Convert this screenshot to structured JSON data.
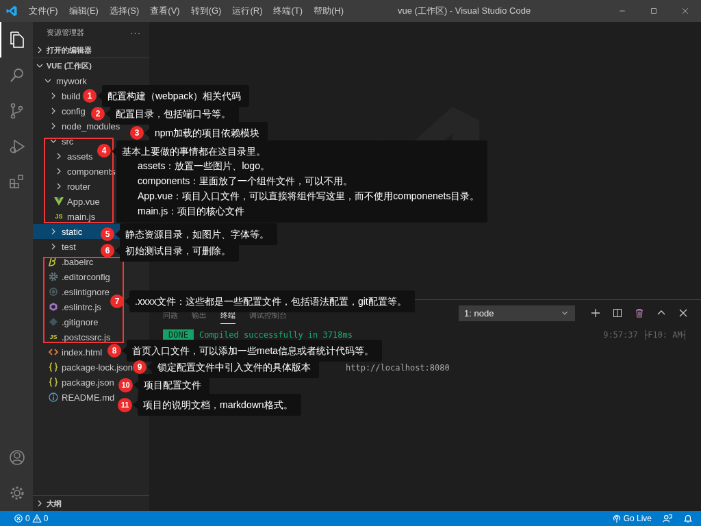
{
  "window": {
    "title": "vue (工作区) - Visual Studio Code"
  },
  "menu": [
    "文件(F)",
    "编辑(E)",
    "选择(S)",
    "查看(V)",
    "转到(G)",
    "运行(R)",
    "终端(T)",
    "帮助(H)"
  ],
  "activity_bar": [
    {
      "kind": "files",
      "selected": true
    },
    {
      "kind": "search",
      "selected": false
    },
    {
      "kind": "scm",
      "selected": false
    },
    {
      "kind": "debug",
      "selected": false
    },
    {
      "kind": "extensions",
      "selected": false
    }
  ],
  "sidebar": {
    "title": "资源管理器",
    "more": "···",
    "sections": [
      {
        "label": "打开的编辑器",
        "expanded": false
      },
      {
        "label": "VUE (工作区)",
        "expanded": true
      }
    ],
    "tree": [
      {
        "label": "mywork",
        "kind": "folder",
        "expanded": true,
        "selected": false,
        "children": [
          {
            "label": "build",
            "kind": "folder",
            "expanded": false,
            "selected": false
          },
          {
            "label": "config",
            "kind": "folder",
            "expanded": false,
            "selected": false
          },
          {
            "label": "node_modules",
            "kind": "folder",
            "expanded": false,
            "selected": false
          },
          {
            "label": "src",
            "kind": "folder",
            "expanded": true,
            "selected": false,
            "children": [
              {
                "label": "assets",
                "kind": "folder",
                "expanded": false,
                "selected": false
              },
              {
                "label": "components",
                "kind": "folder",
                "expanded": false,
                "selected": false
              },
              {
                "label": "router",
                "kind": "folder",
                "expanded": false,
                "selected": false
              },
              {
                "label": "App.vue",
                "kind": "vue",
                "selected": false
              },
              {
                "label": "main.js",
                "kind": "js",
                "icon_text": "JS",
                "selected": false
              }
            ]
          },
          {
            "label": "static",
            "kind": "folder",
            "expanded": false,
            "selected": true
          },
          {
            "label": "test",
            "kind": "folder",
            "expanded": false,
            "selected": false
          },
          {
            "label": ".babelrc",
            "kind": "babel",
            "selected": false
          },
          {
            "label": ".editorconfig",
            "kind": "gear",
            "selected": false
          },
          {
            "label": ".eslintignore",
            "kind": "ring",
            "selected": false
          },
          {
            "label": ".eslintrc.js",
            "kind": "eslint",
            "selected": false
          },
          {
            "label": ".gitignore",
            "kind": "git",
            "selected": false
          },
          {
            "label": ".postcssrc.js",
            "kind": "js",
            "icon_text": "JS",
            "selected": false
          },
          {
            "label": "index.html",
            "kind": "html",
            "selected": false
          },
          {
            "label": "package-lock.json",
            "kind": "json",
            "selected": false
          },
          {
            "label": "package.json",
            "kind": "json",
            "selected": false
          },
          {
            "label": "README.md",
            "kind": "info",
            "selected": false
          }
        ]
      }
    ],
    "outline": {
      "label": "大纲",
      "expanded": false
    }
  },
  "panel": {
    "tabs": [
      {
        "label": "问题",
        "selected": false
      },
      {
        "label": "输出",
        "selected": false
      },
      {
        "label": "终端",
        "selected": true
      },
      {
        "label": "调试控制台",
        "selected": false
      }
    ],
    "terminal_select": "1: node",
    "lines": [
      {
        "kind": "done",
        "badge": "DONE",
        "text": "Compiled successfully in 3718ms",
        "time": "9:57:37 ├F10: AM┤"
      },
      {
        "kind": "url",
        "text": "http://localhost:8080"
      }
    ]
  },
  "annotations": [
    {
      "number": "1",
      "text": "配置构建（webpack）相关代码"
    },
    {
      "number": "2",
      "text": "配置目录，包括端口号等。"
    },
    {
      "number": "3",
      "text": "npm加载的项目依赖模块"
    },
    {
      "number": "4",
      "text": "基本上要做的事情都在这目录里。",
      "details": [
        "assets：放置一些图片、logo。",
        "components：里面放了一个组件文件，可以不用。",
        "App.vue：项目入口文件，可以直接将组件写这里，而不使用componenets目录。",
        "main.js：项目的核心文件"
      ]
    },
    {
      "number": "5",
      "text": "静态资源目录，如图片、字体等。"
    },
    {
      "number": "6",
      "text": "初始测试目录，可删除。"
    },
    {
      "number": "7",
      "text": ".xxxx文件：这些都是一些配置文件，包括语法配置，git配置等。"
    },
    {
      "number": "8",
      "text": "首页入口文件，可以添加一些meta信息或者统计代码等。"
    },
    {
      "number": "9",
      "text": "锁定配置文件中引入文件的具体版本"
    },
    {
      "number": "10",
      "text": "项目配置文件"
    },
    {
      "number": "11",
      "text": "项目的说明文档，markdown格式。"
    }
  ],
  "status_bar": {
    "errors": "0",
    "warnings": "0",
    "go_live": "Go Live"
  }
}
